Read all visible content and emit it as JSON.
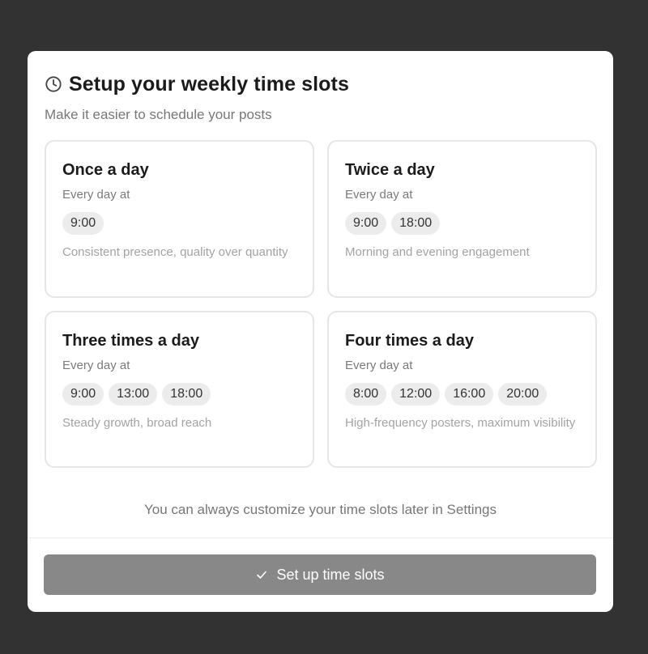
{
  "modal": {
    "title": "Setup your weekly time slots",
    "subtitle": "Make it easier to schedule your posts",
    "title_icon": "clock-icon"
  },
  "options": [
    {
      "title": "Once a day",
      "sub": "Every day at",
      "times": [
        "9:00"
      ],
      "description": "Consistent presence, quality over quantity"
    },
    {
      "title": "Twice a day",
      "sub": "Every day at",
      "times": [
        "9:00",
        "18:00"
      ],
      "description": "Morning and evening engagement"
    },
    {
      "title": "Three times a day",
      "sub": "Every day at",
      "times": [
        "9:00",
        "13:00",
        "18:00"
      ],
      "description": "Steady growth, broad reach"
    },
    {
      "title": "Four times a day",
      "sub": "Every day at",
      "times": [
        "8:00",
        "12:00",
        "16:00",
        "20:00"
      ],
      "description": "High-frequency posters, maximum visibility"
    }
  ],
  "note": "You can always customize your time slots later in Settings",
  "cta": {
    "label": "Set up time slots",
    "icon": "check-icon",
    "color": "#888888"
  },
  "colors": {
    "backdrop": "#323232",
    "card_border": "#e6e6e6",
    "chip_bg": "#ececec"
  }
}
